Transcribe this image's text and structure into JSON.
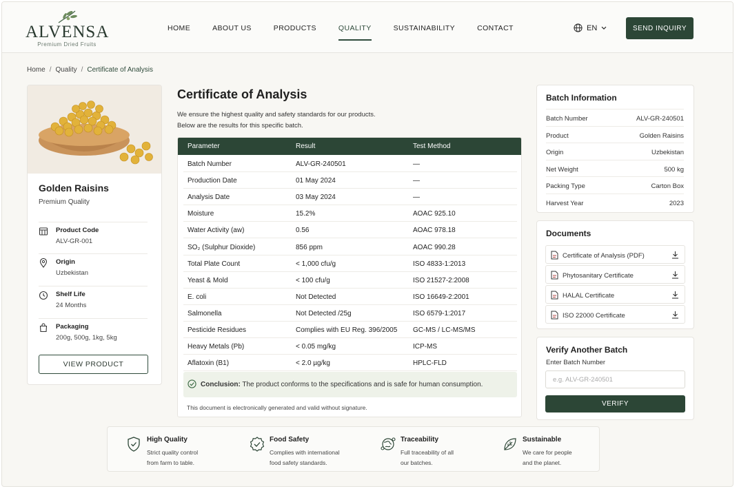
{
  "header": {
    "brand": "ALVENSA",
    "tagline": "Premium Dried Fruits",
    "nav": [
      "HOME",
      "ABOUT US",
      "PRODUCTS",
      "QUALITY",
      "SUSTAINABILITY",
      "CONTACT"
    ],
    "active_nav": "QUALITY",
    "language": "EN",
    "cta": "SEND INQUIRY"
  },
  "breadcrumb": [
    "Home",
    "Quality",
    "Certificate of Analysis"
  ],
  "product": {
    "name": "Golden Raisins",
    "subtitle": "Premium Quality",
    "specs": [
      {
        "icon": "barcode-icon",
        "label": "Product Code",
        "value": "ALV-GR-001"
      },
      {
        "icon": "location-pin-icon",
        "label": "Origin",
        "value": "Uzbekistan"
      },
      {
        "icon": "clock-icon",
        "label": "Shelf Life",
        "value": "24 Months"
      },
      {
        "icon": "shopping-bag-icon",
        "label": "Packaging",
        "value": "200g, 500g, 1kg, 5kg"
      }
    ],
    "view_button": "VIEW PRODUCT"
  },
  "certificate": {
    "title": "Certificate of Analysis",
    "intro_line1": "We ensure the highest quality and safety standards for our products.",
    "intro_line2": "Below are the results for this specific batch.",
    "columns": [
      "Parameter",
      "Result",
      "Test Method"
    ],
    "rows": [
      [
        "Batch Number",
        "ALV-GR-240501",
        "—"
      ],
      [
        "Production Date",
        "01 May 2024",
        "—"
      ],
      [
        "Analysis Date",
        "03 May 2024",
        "—"
      ],
      [
        "Moisture",
        "15.2%",
        "AOAC 925.10"
      ],
      [
        "Water Activity (aw)",
        "0.56",
        "AOAC 978.18"
      ],
      [
        "SO₂ (Sulphur Dioxide)",
        "856 ppm",
        "AOAC 990.28"
      ],
      [
        "Total Plate Count",
        "< 1,000 cfu/g",
        "ISO 4833-1:2013"
      ],
      [
        "Yeast & Mold",
        "< 100 cfu/g",
        "ISO 21527-2:2008"
      ],
      [
        "E. coli",
        "Not Detected",
        "ISO 16649-2:2001"
      ],
      [
        "Salmonella",
        "Not Detected /25g",
        "ISO 6579-1:2017"
      ],
      [
        "Pesticide Residues",
        "Complies with EU Reg. 396/2005",
        "GC-MS / LC-MS/MS"
      ],
      [
        "Heavy Metals (Pb)",
        "< 0.05 mg/kg",
        "ICP-MS"
      ],
      [
        "Aflatoxin (B1)",
        "< 2.0 µg/kg",
        "HPLC-FLD"
      ]
    ],
    "conclusion_label": "Conclusion:",
    "conclusion_text": "The product conforms to the specifications and is safe for human consumption.",
    "footnote": "This document is electronically generated and valid without signature."
  },
  "batch_info": {
    "title": "Batch Information",
    "rows": [
      [
        "Batch Number",
        "ALV-GR-240501"
      ],
      [
        "Product",
        "Golden Raisins"
      ],
      [
        "Origin",
        "Uzbekistan"
      ],
      [
        "Net Weight",
        "500 kg"
      ],
      [
        "Packing Type",
        "Carton Box"
      ],
      [
        "Harvest Year",
        "2023"
      ]
    ]
  },
  "documents": {
    "title": "Documents",
    "items": [
      "Certificate of Analysis (PDF)",
      "Phytosanitary Certificate",
      "HALAL Certificate",
      "ISO 22000 Certificate"
    ]
  },
  "verify": {
    "title": "Verify Another Batch",
    "label": "Enter Batch Number",
    "placeholder": "e.g. ALV-GR-240501",
    "button": "VERIFY"
  },
  "features": [
    {
      "icon": "shield-check-icon",
      "title": "High Quality",
      "line1": "Strict quality control",
      "line2": "from farm to table."
    },
    {
      "icon": "badge-check-icon",
      "title": "Food Safety",
      "line1": "Complies with international",
      "line2": "food safety standards."
    },
    {
      "icon": "globe-trace-icon",
      "title": "Traceability",
      "line1": "Full traceability of all",
      "line2": "our batches."
    },
    {
      "icon": "leaf-icon",
      "title": "Sustainable",
      "line1": "We care for people",
      "line2": "and the planet."
    }
  ],
  "colors": {
    "primary": "#2c4636",
    "background": "#f8f7f3",
    "conclusion_bg": "#eef2e9"
  }
}
